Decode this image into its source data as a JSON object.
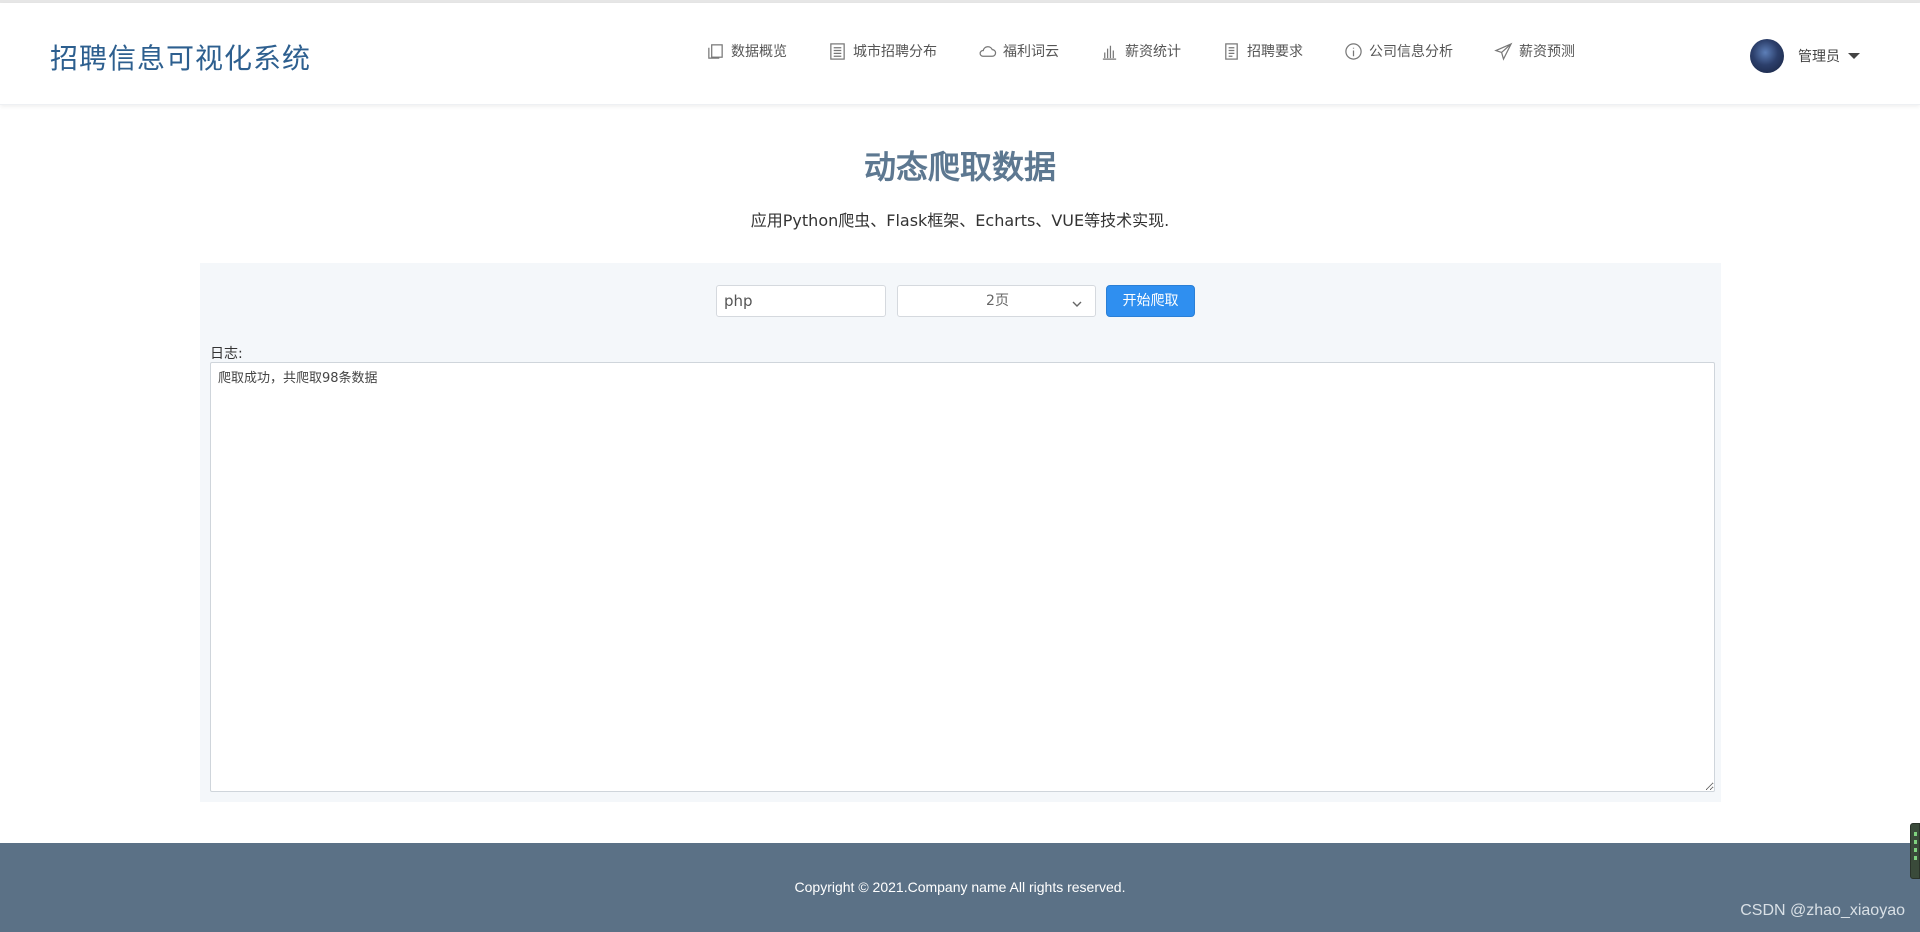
{
  "header": {
    "brand": "招聘信息可视化系统",
    "nav": [
      {
        "label": "数据概览",
        "icon": "copy-icon"
      },
      {
        "label": "城市招聘分布",
        "icon": "list-icon"
      },
      {
        "label": "福利词云",
        "icon": "cloud-icon"
      },
      {
        "label": "薪资统计",
        "icon": "bar-chart-icon"
      },
      {
        "label": "招聘要求",
        "icon": "document-icon"
      },
      {
        "label": "公司信息分析",
        "icon": "info-icon"
      },
      {
        "label": "薪资预测",
        "icon": "send-icon"
      }
    ],
    "user": {
      "name": "管理员"
    }
  },
  "main": {
    "title": "动态爬取数据",
    "subtitle": "应用Python爬虫、Flask框架、Echarts、VUE等技术实现.",
    "keyword": {
      "value": "php"
    },
    "pages": {
      "selected": "2页"
    },
    "start_label": "开始爬取",
    "log_label": "日志:",
    "log_text": "爬取成功，共爬取98条数据"
  },
  "footer": {
    "copyright": "Copyright © 2021.Company name All rights reserved.",
    "watermark": "CSDN @zhao_xiaoyao"
  },
  "colors": {
    "brand": "#2d5f8f",
    "title": "#5d7891",
    "button": "#2f8ff0",
    "footer": "#5b7186",
    "panel": "#f4f7fa"
  }
}
